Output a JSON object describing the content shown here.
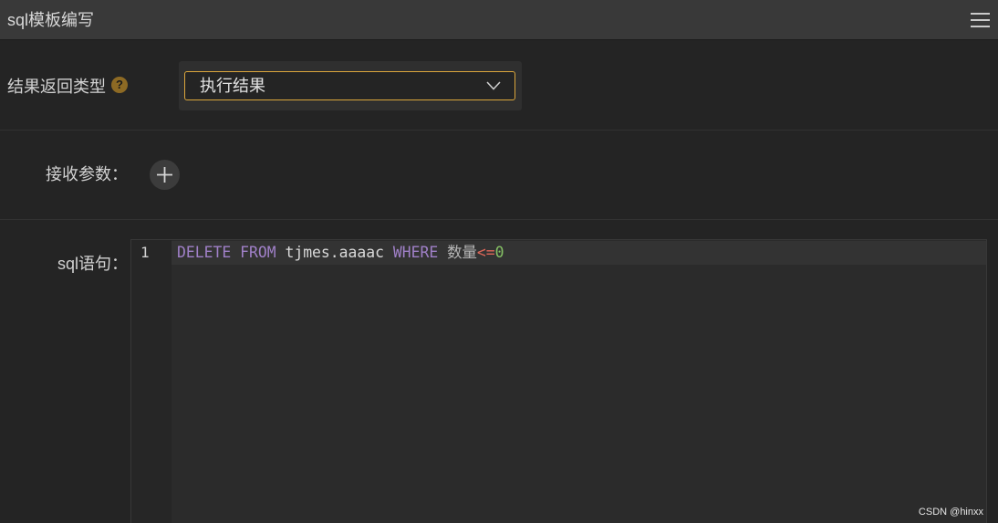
{
  "header": {
    "title": "sql模板编写",
    "menu_icon": "hamburger-menu-icon"
  },
  "result_type": {
    "label": "结果返回类型",
    "help_icon": "question-circle-icon",
    "help_glyph": "?",
    "selected_value": "执行结果",
    "dropdown_icon": "chevron-down-icon"
  },
  "params": {
    "label": "接收参数：",
    "add_icon": "plus-icon"
  },
  "sql": {
    "label": "sql语句：",
    "line_number": "1",
    "tokens": [
      {
        "text": "DELETE",
        "type": "keyword"
      },
      {
        "text": "FROM",
        "type": "keyword"
      },
      {
        "text": "tjmes.aaaac",
        "type": "identifier"
      },
      {
        "text": "WHERE",
        "type": "keyword"
      },
      {
        "text": "数量",
        "type": "column"
      },
      {
        "text": "<=",
        "type": "operator"
      },
      {
        "text": "0",
        "type": "number"
      }
    ]
  },
  "watermark": "CSDN @hinxx",
  "colors": {
    "accent": "#dba63c",
    "keyword": "#a080c8",
    "operator": "#e0685a",
    "number": "#86c265",
    "identifier": "#dadada",
    "help": "#8d6a24"
  }
}
